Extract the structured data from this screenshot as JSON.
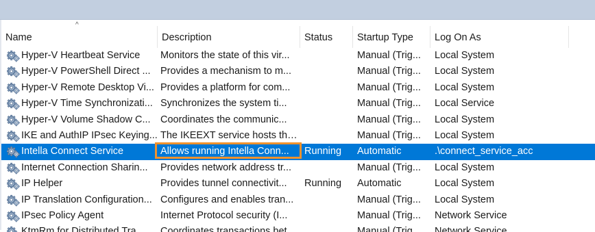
{
  "columns": {
    "name": "Name",
    "description": "Description",
    "status": "Status",
    "startup_type": "Startup Type",
    "log_on_as": "Log On As",
    "sort_indicator": "^"
  },
  "icon": "gear-service-icon",
  "selection_color": "#0078d7",
  "highlight_color": "#f0922e",
  "services": [
    {
      "name": "Hyper-V Heartbeat Service",
      "description": "Monitors the state of this vir...",
      "status": "",
      "startup_type": "Manual (Trig...",
      "log_on_as": "Local System"
    },
    {
      "name": "Hyper-V PowerShell Direct ...",
      "description": "Provides a mechanism to m...",
      "status": "",
      "startup_type": "Manual (Trig...",
      "log_on_as": "Local System"
    },
    {
      "name": "Hyper-V Remote Desktop Vi...",
      "description": "Provides a platform for com...",
      "status": "",
      "startup_type": "Manual (Trig...",
      "log_on_as": "Local System"
    },
    {
      "name": "Hyper-V Time Synchronizati...",
      "description": "Synchronizes the system ti...",
      "status": "",
      "startup_type": "Manual (Trig...",
      "log_on_as": "Local Service"
    },
    {
      "name": "Hyper-V Volume Shadow C...",
      "description": "Coordinates the communic...",
      "status": "",
      "startup_type": "Manual (Trig...",
      "log_on_as": "Local System"
    },
    {
      "name": "IKE and AuthIP IPsec Keying...",
      "description": "The IKEEXT service hosts the...",
      "status": "",
      "startup_type": "Manual (Trig...",
      "log_on_as": "Local System"
    },
    {
      "name": "Intella Connect Service",
      "description": "Allows running Intella Conn...",
      "status": "Running",
      "startup_type": "Automatic",
      "log_on_as": ".\\connect_service_acc",
      "selected": true
    },
    {
      "name": "Internet Connection Sharin...",
      "description": "Provides network address tr...",
      "status": "",
      "startup_type": "Manual (Trig...",
      "log_on_as": "Local System"
    },
    {
      "name": "IP Helper",
      "description": "Provides tunnel connectivit...",
      "status": "Running",
      "startup_type": "Automatic",
      "log_on_as": "Local System"
    },
    {
      "name": "IP Translation Configuration...",
      "description": "Configures and enables tran...",
      "status": "",
      "startup_type": "Manual (Trig...",
      "log_on_as": "Local System"
    },
    {
      "name": "IPsec Policy Agent",
      "description": "Internet Protocol security (I...",
      "status": "",
      "startup_type": "Manual (Trig...",
      "log_on_as": "Network Service"
    },
    {
      "name": "KtmRm for Distributed Tra...",
      "description": "Coordinates transactions bet...",
      "status": "",
      "startup_type": "Manual (Trig...",
      "log_on_as": "Network Service"
    }
  ]
}
